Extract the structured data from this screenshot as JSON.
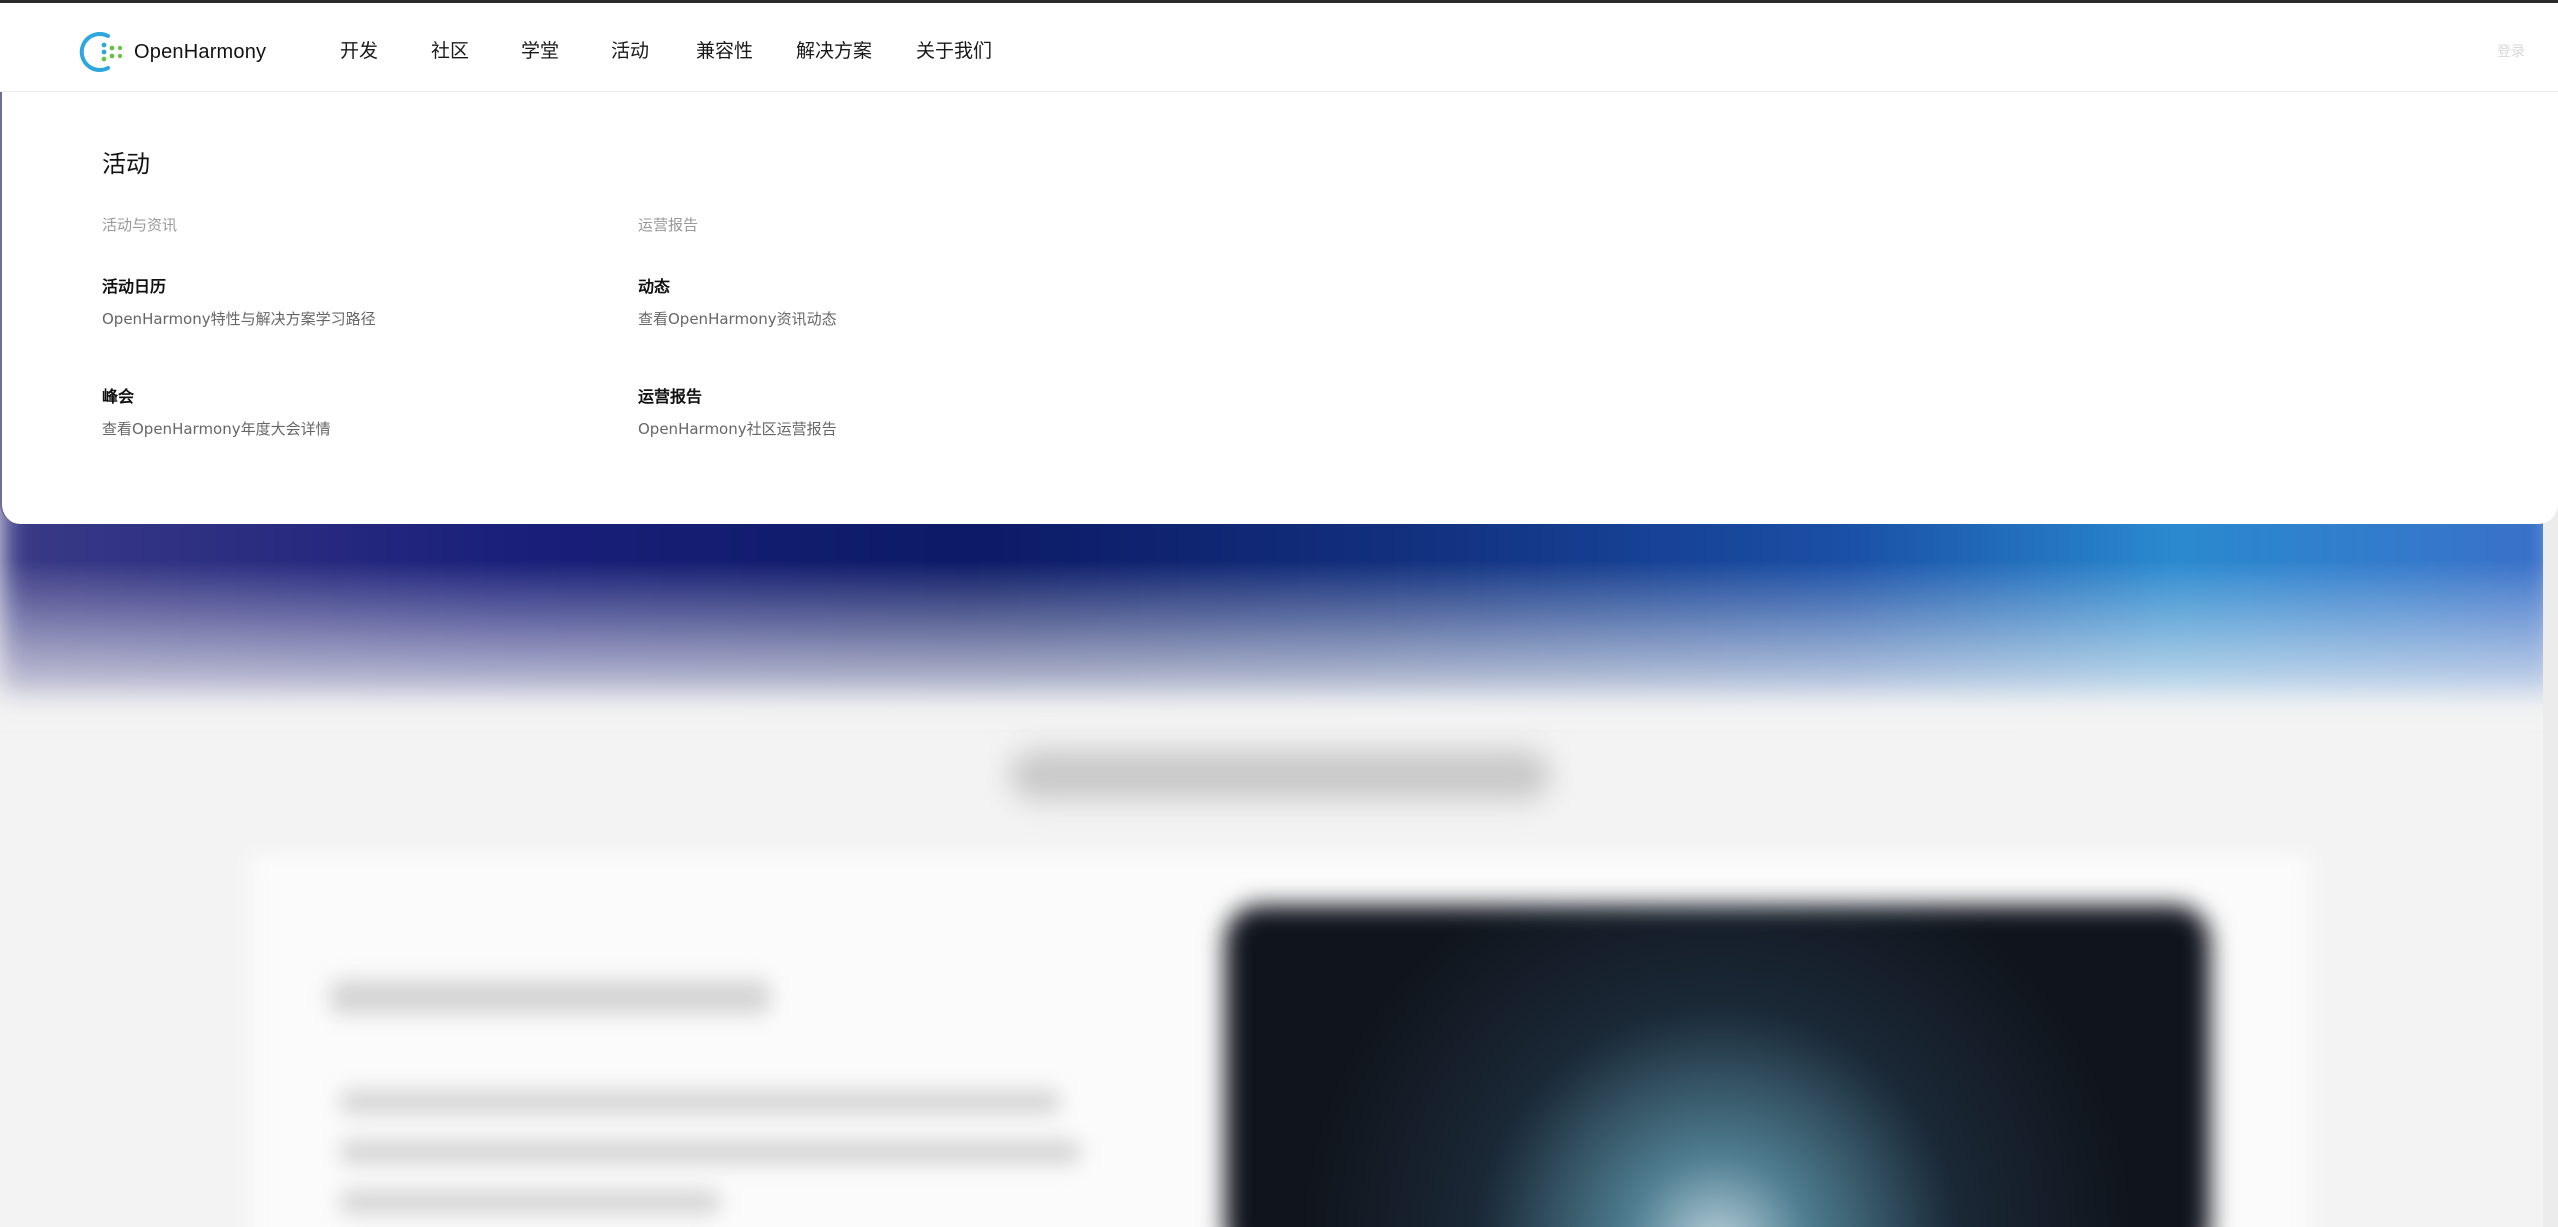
{
  "header": {
    "logo_text": "OpenHarmony",
    "nav": [
      {
        "label": "开发"
      },
      {
        "label": "社区"
      },
      {
        "label": "学堂"
      },
      {
        "label": "活动",
        "active": true
      },
      {
        "label": "兼容性"
      },
      {
        "label": "解决方案"
      },
      {
        "label": "关于我们"
      }
    ],
    "login_label": "登录"
  },
  "dropdown": {
    "title": "活动",
    "columns": [
      {
        "group_label": "活动与资讯",
        "links": [
          {
            "title": "活动日历",
            "desc": "OpenHarmony特性与解决方案学习路径"
          },
          {
            "title": "峰会",
            "desc": "查看OpenHarmony年度大会详情"
          }
        ]
      },
      {
        "group_label": "运营报告",
        "links": [
          {
            "title": "动态",
            "desc": "查看OpenHarmony资讯动态"
          },
          {
            "title": "运营报告",
            "desc": "OpenHarmony社区运营报告"
          }
        ]
      }
    ]
  },
  "colors": {
    "logo_blue": "#2ea6e0",
    "logo_green": "#6cc04a",
    "hero_dark_blue": "#0c1a66",
    "hero_light_blue": "#2a8ad0"
  },
  "icons": [
    "openharmony-logo-icon"
  ]
}
